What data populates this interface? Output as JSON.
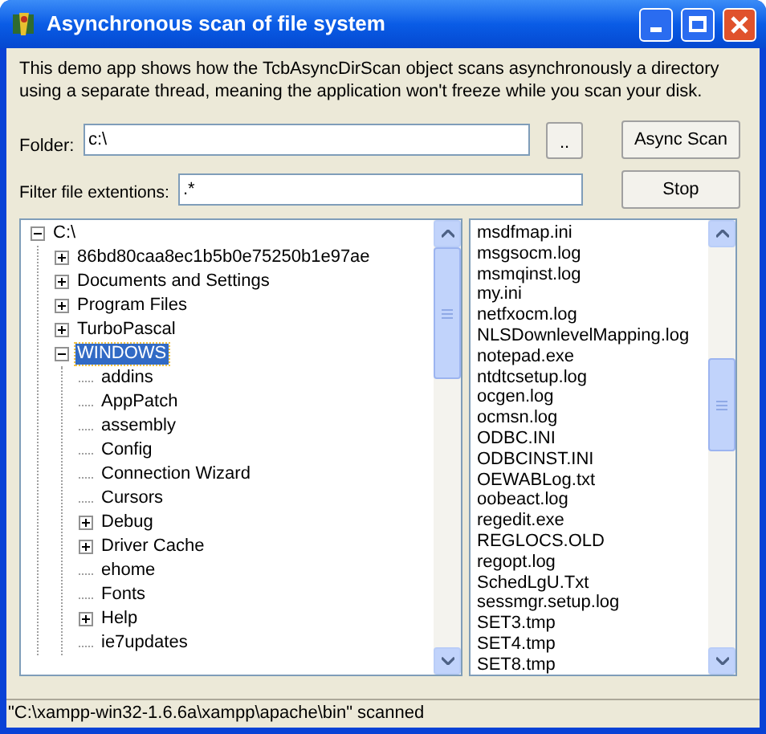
{
  "window": {
    "title": "Asynchronous scan of file system"
  },
  "description": "This demo app shows how the TcbAsyncDirScan object scans asynchronously a directory using a separate thread, meaning the application won't freeze while you scan your disk.",
  "folder": {
    "label": "Folder:",
    "value": "c:\\",
    "browse_button": ".."
  },
  "filter": {
    "label": "Filter file extentions:",
    "value": ".*"
  },
  "buttons": [
    {
      "label": "Async Scan"
    },
    {
      "label": "Stop"
    }
  ],
  "tree": {
    "label": "C:\\",
    "kind": "expanded",
    "selected": false,
    "children": [
      {
        "label": "86bd80caa8ec1b5b0e75250b1e97ae",
        "kind": "collapsed",
        "selected": false
      },
      {
        "label": "Documents and Settings",
        "kind": "collapsed",
        "selected": false
      },
      {
        "label": "Program Files",
        "kind": "collapsed",
        "selected": false
      },
      {
        "label": "TurboPascal",
        "kind": "collapsed",
        "selected": false
      },
      {
        "label": "WINDOWS",
        "kind": "expanded",
        "selected": true,
        "children": [
          {
            "label": "addins",
            "kind": "leaf",
            "selected": false
          },
          {
            "label": "AppPatch",
            "kind": "leaf",
            "selected": false
          },
          {
            "label": "assembly",
            "kind": "leaf",
            "selected": false
          },
          {
            "label": "Config",
            "kind": "leaf",
            "selected": false
          },
          {
            "label": "Connection Wizard",
            "kind": "leaf",
            "selected": false
          },
          {
            "label": "Cursors",
            "kind": "leaf",
            "selected": false
          },
          {
            "label": "Debug",
            "kind": "collapsed",
            "selected": false
          },
          {
            "label": "Driver Cache",
            "kind": "collapsed",
            "selected": false
          },
          {
            "label": "ehome",
            "kind": "leaf",
            "selected": false
          },
          {
            "label": "Fonts",
            "kind": "leaf",
            "selected": false
          },
          {
            "label": "Help",
            "kind": "collapsed",
            "selected": false
          },
          {
            "label": "ie7updates",
            "kind": "leaf",
            "selected": false
          }
        ]
      }
    ]
  },
  "files": [
    "msdfmap.ini",
    "msgsocm.log",
    "msmqinst.log",
    "my.ini",
    "netfxocm.log",
    "NLSDownlevelMapping.log",
    "notepad.exe",
    "ntdtcsetup.log",
    "ocgen.log",
    "ocmsn.log",
    "ODBC.INI",
    "ODBCINST.INI",
    "OEWABLog.txt",
    "oobeact.log",
    "regedit.exe",
    "REGLOCS.OLD",
    "regopt.log",
    "SchedLgU.Txt",
    "sessmgr.setup.log",
    "SET3.tmp",
    "SET4.tmp",
    "SET8.tmp"
  ],
  "status_bar": "\"C:\\xampp-win32-1.6.6a\\xampp\\apache\\bin\" scanned"
}
